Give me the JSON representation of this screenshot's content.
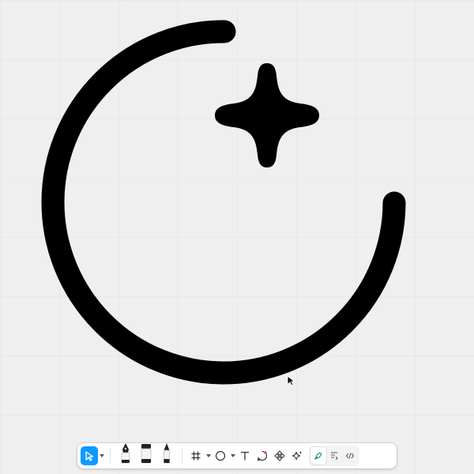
{
  "app": {
    "canvas_color": "#efefef",
    "accent_color": "#0d99ff"
  },
  "artwork": {
    "shapes": [
      "open-circle-arc",
      "four-point-sparkle"
    ],
    "stroke_color": "#000000"
  },
  "toolbar": {
    "tools": [
      {
        "name": "move-tool",
        "icon": "cursor-arrow-icon",
        "active": true
      },
      {
        "name": "pen-tool",
        "icon": "fountain-pen-icon"
      },
      {
        "name": "marker-tool",
        "icon": "marker-icon"
      },
      {
        "name": "pencil-tool",
        "icon": "pencil-icon"
      },
      {
        "name": "frame-tool",
        "icon": "frame-hash-icon"
      },
      {
        "name": "shape-tool",
        "icon": "ellipse-icon"
      },
      {
        "name": "text-tool",
        "icon": "text-T-icon"
      },
      {
        "name": "comment-tool",
        "icon": "comment-bubble-icon"
      },
      {
        "name": "component-tool",
        "icon": "component-diamond-icon"
      },
      {
        "name": "ai-tool",
        "icon": "sparkle-icon"
      }
    ],
    "modes": [
      {
        "name": "design-mode",
        "icon": "design-pen-icon",
        "selected": true
      },
      {
        "name": "prototype-mode",
        "icon": "prototype-icon"
      },
      {
        "name": "dev-mode",
        "icon": "code-brackets-icon"
      }
    ]
  }
}
